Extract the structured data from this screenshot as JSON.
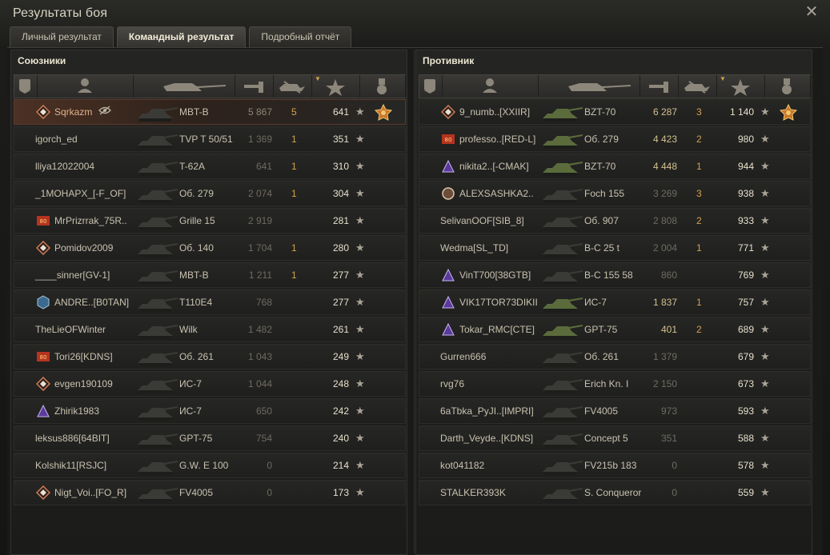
{
  "window": {
    "title": "Результаты боя",
    "close_icon": "close-icon"
  },
  "tabs": [
    {
      "label": "Личный результат",
      "active": false
    },
    {
      "label": "Командный результат",
      "active": true
    },
    {
      "label": "Подробный отчёт",
      "active": false
    }
  ],
  "columns": [
    "badge-icon",
    "player-icon",
    "tank-icon",
    "damage-icon",
    "kills-icon",
    "xp-star-icon",
    "medal-icon"
  ],
  "sort_marker": "▼",
  "colors": {
    "accent_kills": "#d3a24e",
    "highlight_row": "#4c3124",
    "damage_highlight": "#d2c08e"
  },
  "allies": {
    "title": "Союзники",
    "rows": [
      {
        "player": "Sqrkazm",
        "badge": "diamond",
        "vehicle": "MBT-B",
        "damage": "5 867",
        "kills": "5",
        "xp": "641",
        "medal": true,
        "me": true,
        "eye": true
      },
      {
        "player": "igorch_ed",
        "badge": "",
        "vehicle": "TVP T 50/51",
        "damage": "1 369",
        "kills": "1",
        "xp": "351",
        "medal": false
      },
      {
        "player": "lliya12022004",
        "badge": "",
        "vehicle": "T-62A",
        "damage": "641",
        "kills": "1",
        "xp": "310",
        "medal": false
      },
      {
        "player": "_1MOHAPX_[-F_OF]",
        "badge": "",
        "vehicle": "Об. 279",
        "damage": "2 074",
        "kills": "1",
        "xp": "304",
        "medal": false
      },
      {
        "player": "MrPrizrrak_75R..",
        "badge": "clan-red",
        "vehicle": "Grille 15",
        "damage": "2 919",
        "kills": "",
        "xp": "281",
        "medal": false
      },
      {
        "player": "Pomidov2009",
        "badge": "diamond",
        "vehicle": "Об. 140",
        "damage": "1 704",
        "kills": "1",
        "xp": "280",
        "medal": false
      },
      {
        "player": "____sinner[GV-1]",
        "badge": "",
        "vehicle": "MBT-B",
        "damage": "1 211",
        "kills": "1",
        "xp": "277",
        "medal": false
      },
      {
        "player": "ANDRE..[B0TAN]",
        "badge": "clan-blue",
        "vehicle": "T110E4",
        "damage": "768",
        "kills": "",
        "xp": "277",
        "medal": false
      },
      {
        "player": "TheLieOFWinter",
        "badge": "",
        "vehicle": "Wilk",
        "damage": "1 482",
        "kills": "",
        "xp": "261",
        "medal": false
      },
      {
        "player": "Tori26[KDNS]",
        "badge": "clan-red",
        "vehicle": "Об. 261",
        "damage": "1 043",
        "kills": "",
        "xp": "249",
        "medal": false
      },
      {
        "player": "evgen190109",
        "badge": "diamond",
        "vehicle": "ИС-7",
        "damage": "1 044",
        "kills": "",
        "xp": "248",
        "medal": false
      },
      {
        "player": "Zhirik1983",
        "badge": "clan-purple",
        "vehicle": "ИС-7",
        "damage": "650",
        "kills": "",
        "xp": "242",
        "medal": false
      },
      {
        "player": "leksus886[64BIT]",
        "badge": "",
        "vehicle": "GPT-75",
        "damage": "754",
        "kills": "",
        "xp": "240",
        "medal": false
      },
      {
        "player": "Kolshik11[RSJC]",
        "badge": "",
        "vehicle": "G.W. E 100",
        "damage": "0",
        "kills": "",
        "xp": "214",
        "medal": false
      },
      {
        "player": "Nigt_Voi..[FO_R]",
        "badge": "diamond",
        "vehicle": "FV4005",
        "damage": "0",
        "kills": "",
        "xp": "173",
        "medal": false
      }
    ]
  },
  "enemies": {
    "title": "Противник",
    "rows": [
      {
        "player": "9_numb..[XXIIR]",
        "badge": "diamond",
        "vehicle": "BZT-70",
        "damage": "6 287",
        "kills": "3",
        "xp": "1 140",
        "medal": true,
        "hl": true
      },
      {
        "player": "professo..[RED-L]",
        "badge": "clan-red",
        "vehicle": "Об. 279",
        "damage": "4 423",
        "kills": "2",
        "xp": "980",
        "medal": false,
        "hl": true
      },
      {
        "player": "nikita2..[-CMAK]",
        "badge": "clan-purple",
        "vehicle": "BZT-70",
        "damage": "4 448",
        "kills": "1",
        "xp": "944",
        "medal": false,
        "hl": true
      },
      {
        "player": "ALEXSASHKA2..",
        "badge": "clan-round",
        "vehicle": "Foch 155",
        "damage": "3 269",
        "kills": "3",
        "xp": "938",
        "medal": false
      },
      {
        "player": "SelivanOOF[SIB_8]",
        "badge": "",
        "vehicle": "Об. 907",
        "damage": "2 808",
        "kills": "2",
        "xp": "933",
        "medal": false
      },
      {
        "player": "Wedma[SL_TD]",
        "badge": "",
        "vehicle": "B-C 25 t",
        "damage": "2 004",
        "kills": "1",
        "xp": "771",
        "medal": false
      },
      {
        "player": "VinT700[38GTB]",
        "badge": "clan-purple",
        "vehicle": "B-C 155 58",
        "damage": "860",
        "kills": "",
        "xp": "769",
        "medal": false
      },
      {
        "player": "VIK17TOR73DIKII",
        "badge": "clan-purple",
        "vehicle": "ИС-7",
        "damage": "1 837",
        "kills": "1",
        "xp": "757",
        "medal": false,
        "hl": true
      },
      {
        "player": "Tokar_RMC[CTE]",
        "badge": "clan-purple",
        "vehicle": "GPT-75",
        "damage": "401",
        "kills": "2",
        "xp": "689",
        "medal": false,
        "hl": true
      },
      {
        "player": "Gurren666",
        "badge": "",
        "vehicle": "Об. 261",
        "damage": "1 379",
        "kills": "",
        "xp": "679",
        "medal": false
      },
      {
        "player": "rvg76",
        "badge": "",
        "vehicle": "Erich Kn. I",
        "damage": "2 150",
        "kills": "",
        "xp": "673",
        "medal": false
      },
      {
        "player": "6aTbka_PyJI..[IMPRI]",
        "badge": "",
        "vehicle": "FV4005",
        "damage": "973",
        "kills": "",
        "xp": "593",
        "medal": false
      },
      {
        "player": "Darth_Veyde..[KDNS]",
        "badge": "",
        "vehicle": "Concept 5",
        "damage": "351",
        "kills": "",
        "xp": "588",
        "medal": false
      },
      {
        "player": "kot041182",
        "badge": "",
        "vehicle": "FV215b 183",
        "damage": "0",
        "kills": "",
        "xp": "578",
        "medal": false
      },
      {
        "player": "STALKER393K",
        "badge": "",
        "vehicle": "S. Conqueror",
        "damage": "0",
        "kills": "",
        "xp": "559",
        "medal": false
      }
    ]
  }
}
